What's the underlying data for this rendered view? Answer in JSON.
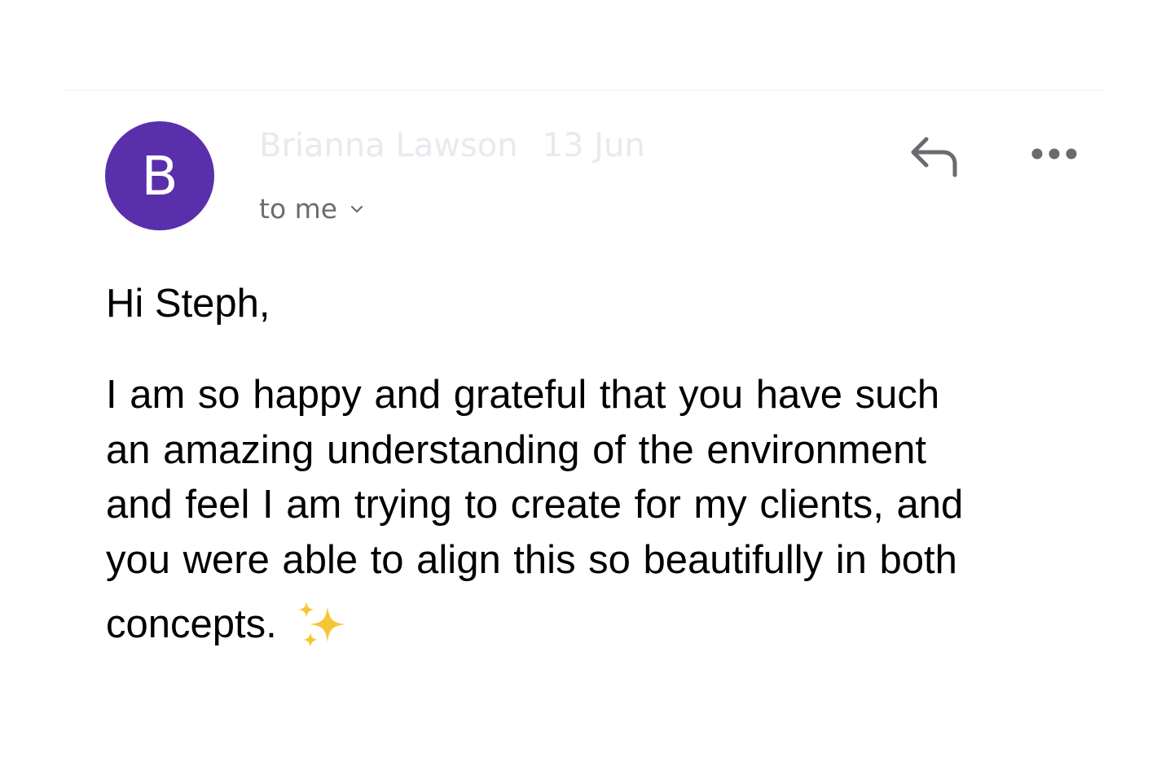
{
  "header": {
    "avatar_letter": "B",
    "avatar_color": "#5a2fac",
    "sender_name": "Brianna Lawson",
    "date": "13 Jun",
    "recipient_label": "to me",
    "recipient_toggle_icon": "chevron-down-icon",
    "reply_icon": "reply-icon",
    "more_icon": "more-horizontal-icon"
  },
  "message": {
    "greeting": "Hi Steph,",
    "lines": [
      "I am so happy and grateful that you have such",
      "an amazing understanding of the environment",
      "and feel I am trying to create for my clients, and",
      "you were able to align this so beautifully in both"
    ],
    "last_line": "concepts.",
    "emoji_icon": "sparkles-icon"
  }
}
